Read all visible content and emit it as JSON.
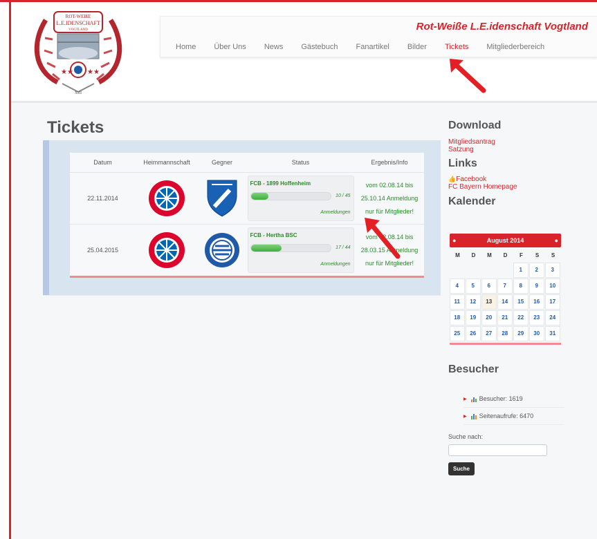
{
  "logo": {
    "line1": "ROT-WEIßE",
    "line2": "L.E.IDENSCHAFT",
    "line3": "VOGTLAND",
    "numeral": "XIII"
  },
  "site_title": "Rot-Weiße L.E.idenschaft Vogtland",
  "nav": {
    "items": [
      "Home",
      "Über Uns",
      "News",
      "Gästebuch",
      "Fanartikel",
      "Bilder",
      "Tickets",
      "Mitgliederbereich"
    ],
    "active": "Tickets"
  },
  "main": {
    "title": "Tickets",
    "headers": [
      "Datum",
      "Heimmannschaft",
      "Gegner",
      "Status",
      "Ergebnis/Info"
    ],
    "rows": [
      {
        "date": "22.11.2014",
        "match": "FCB - 1899 Hoffenheim",
        "count": "10 / 45",
        "progress": 0.222,
        "link": "Anmeldungen",
        "info": [
          "vom 02.08.14 bis",
          "25.10.14 Anmeldung",
          "nur für Mitglieder!"
        ]
      },
      {
        "date": "25.04.2015",
        "match": "FCB - Hertha BSC",
        "count": "17 / 44",
        "progress": 0.386,
        "link": "Anmeldungen",
        "info": [
          "vom 02.08.14 bis",
          "28.03.15 Anmeldung",
          "nur für Mitglieder!"
        ]
      }
    ]
  },
  "sidebar": {
    "download_title": "Download",
    "downloads": [
      "Mitgliedsantrag",
      "Satzung"
    ],
    "links_title": "Links",
    "links": [
      "Facebook",
      "FC Bayern Homepage"
    ],
    "calendar_title": "Kalender",
    "calendar": {
      "month": "August 2014",
      "weekdays": [
        "M",
        "D",
        "M",
        "D",
        "F",
        "S",
        "S"
      ],
      "days": [
        "",
        "",
        "",
        "",
        "1",
        "2",
        "3",
        "4",
        "5",
        "6",
        "7",
        "8",
        "9",
        "10",
        "11",
        "12",
        "13",
        "14",
        "15",
        "16",
        "17",
        "18",
        "19",
        "20",
        "21",
        "22",
        "23",
        "24",
        "25",
        "26",
        "27",
        "28",
        "29",
        "30",
        "31"
      ],
      "today": "13"
    },
    "visitors_title": "Besucher",
    "visitors": [
      "Besucher: 1619",
      "Seitenaufrufe: 6470"
    ],
    "search_label": "Suche nach:",
    "search_button": "Suche"
  },
  "colors": {
    "accent": "#d8232a",
    "success": "#2a8a2a",
    "link": "#1e5aa8"
  }
}
